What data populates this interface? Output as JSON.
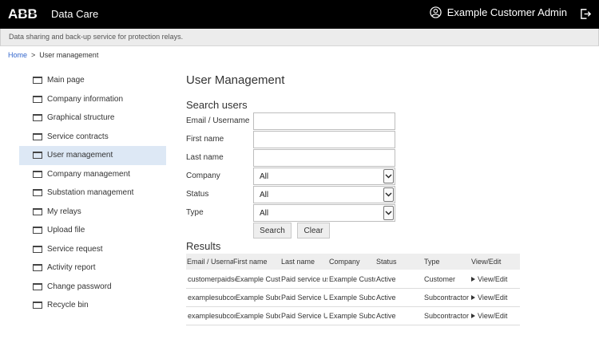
{
  "header": {
    "logo_text": "ABB",
    "app_title": "Data Care",
    "user_name": "Example Customer Admin",
    "icons": {
      "user": "user-circle-icon",
      "logout": "logout-icon"
    }
  },
  "subheader": {
    "tagline": "Data sharing and back-up service for protection relays."
  },
  "breadcrumb": {
    "home": "Home",
    "separator": ">",
    "current": "User management"
  },
  "sidebar": {
    "items": [
      {
        "label": "Main page",
        "active": false
      },
      {
        "label": "Company information",
        "active": false
      },
      {
        "label": "Graphical structure",
        "active": false
      },
      {
        "label": "Service contracts",
        "active": false
      },
      {
        "label": "User management",
        "active": true
      },
      {
        "label": "Company management",
        "active": false
      },
      {
        "label": "Substation management",
        "active": false
      },
      {
        "label": "My relays",
        "active": false
      },
      {
        "label": "Upload file",
        "active": false
      },
      {
        "label": "Service request",
        "active": false
      },
      {
        "label": "Activity report",
        "active": false
      },
      {
        "label": "Change password",
        "active": false
      },
      {
        "label": "Recycle bin",
        "active": false
      }
    ]
  },
  "main": {
    "title": "User Management",
    "search": {
      "title": "Search users",
      "email_label": "Email / Username",
      "email_value": "",
      "first_name_label": "First name",
      "first_name_value": "",
      "last_name_label": "Last name",
      "last_name_value": "",
      "company_label": "Company",
      "company_value": "All",
      "status_label": "Status",
      "status_value": "All",
      "type_label": "Type",
      "type_value": "All",
      "search_button": "Search",
      "clear_button": "Clear"
    },
    "results": {
      "title": "Results",
      "columns": [
        "Email / Username",
        "First name",
        "Last name",
        "Company",
        "Status",
        "Type",
        "View/Edit"
      ],
      "rows": [
        [
          "customerpaidservice",
          "Example Customer",
          "Paid service user",
          "Example Customer",
          "Active",
          "Customer",
          "View/Edit"
        ],
        [
          "examplesubcontractor",
          "Example Subcontractor",
          "Paid Service User",
          "Example Subcontractor",
          "Active",
          "Subcontractor",
          "View/Edit"
        ],
        [
          "examplesubcontractor",
          "Example Subcontractor",
          "Paid Service User",
          "Example Subcontractor",
          "Active",
          "Subcontractor",
          "View/Edit"
        ]
      ]
    }
  },
  "colors": {
    "topbar": "#000000",
    "active_nav": "#dde8f5",
    "link": "#3366cc",
    "table_header": "#eeeeee"
  }
}
